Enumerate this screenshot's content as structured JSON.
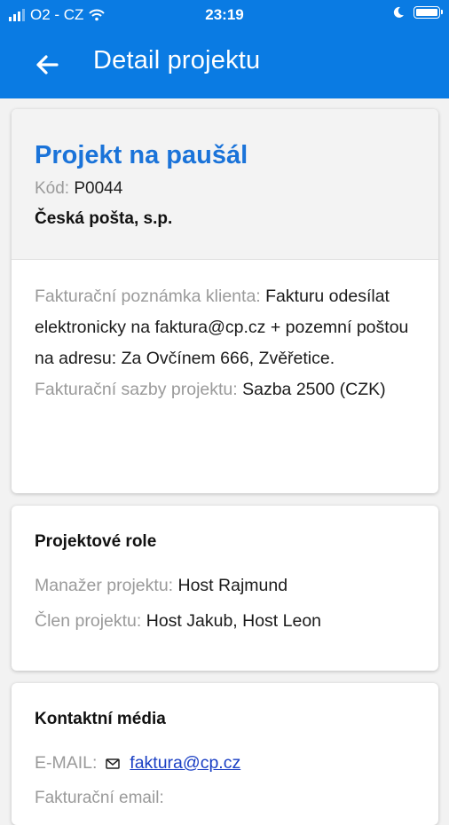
{
  "status_bar": {
    "carrier": "O2 - CZ",
    "time": "23:19"
  },
  "app_bar": {
    "title": "Detail projektu"
  },
  "project": {
    "name": "Projekt na paušál",
    "code_label": "Kód:",
    "code": "P0044",
    "client": "Česká pošta, s.p.",
    "billing_note_label": "Fakturační poznámka klienta:",
    "billing_note": "Fakturu odesílat elektronicky na faktura@cp.cz + pozemní poštou na adresu: Za Ovčínem 666, Zvěřetice.",
    "rates_label": "Fakturační sazby projektu:",
    "rates": "Sazba 2500 (CZK)"
  },
  "roles": {
    "title": "Projektové role",
    "manager_label": "Manažer projektu:",
    "manager": "Host Rajmund",
    "member_label": "Člen projektu:",
    "members": "Host Jakub, Host Leon"
  },
  "contacts": {
    "title": "Kontaktní média",
    "email_label": "E-MAIL:",
    "email": "faktura@cp.cz",
    "next_label_partial": "Fakturační email:"
  },
  "colors": {
    "primary": "#0a7be3",
    "project_title": "#1a73d9",
    "link": "#1a3fc4"
  }
}
